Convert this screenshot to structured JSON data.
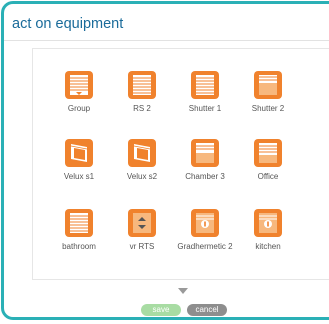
{
  "dialog": {
    "title": "act on equipment"
  },
  "colors": {
    "accent": "#2ab0b6",
    "title_text": "#1a6b9a",
    "icon_orange": "#f0822d",
    "icon_light": "#f7b87e",
    "save_button": "#a8dca3",
    "cancel_button": "#8e8e8e"
  },
  "equipment": [
    {
      "label": "Group",
      "icon": "group-shutter-icon"
    },
    {
      "label": "RS 2",
      "icon": "roller-shutter-icon"
    },
    {
      "label": "Shutter 1",
      "icon": "roller-shutter-icon"
    },
    {
      "label": "Shutter 2",
      "icon": "roller-shutter-half-icon"
    },
    {
      "label": "Velux s1",
      "icon": "roof-window-icon"
    },
    {
      "label": "Velux s2",
      "icon": "roof-window-icon"
    },
    {
      "label": "Chamber 3",
      "icon": "roller-shutter-half-icon"
    },
    {
      "label": "Office",
      "icon": "roller-shutter-half-icon"
    },
    {
      "label": "bathroom",
      "icon": "roller-shutter-icon"
    },
    {
      "label": "vr RTS",
      "icon": "rts-shutter-icon"
    },
    {
      "label": "Gradhermetic 2",
      "icon": "gradhermetic-icon"
    },
    {
      "label": "kitchen",
      "icon": "gradhermetic-icon"
    }
  ],
  "actions": {
    "save_label": "save",
    "cancel_label": "cancel"
  }
}
